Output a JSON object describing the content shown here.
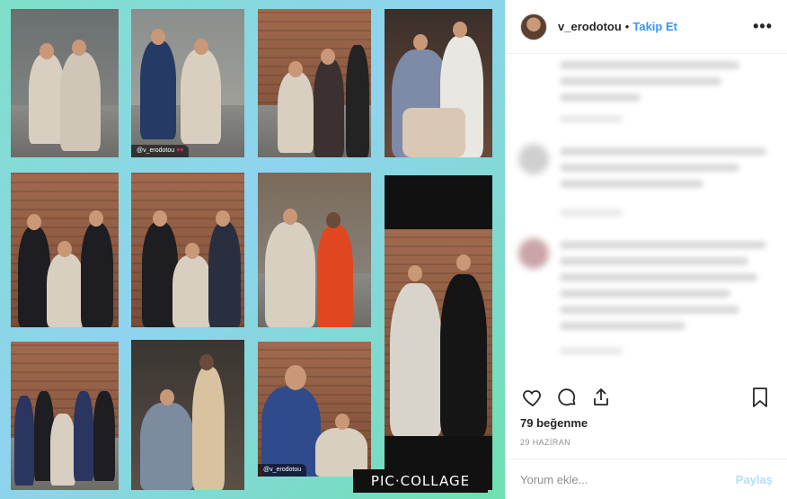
{
  "header": {
    "username": "v_erodotou",
    "separator": "•",
    "follow_label": "Takip Et",
    "more_label": "•••"
  },
  "photo": {
    "tag_text": "@v_erodotou",
    "hearts": "♥♥",
    "brand": "PIC·COLLAGE"
  },
  "actions": {
    "like_icon": "heart-outline-icon",
    "comment_icon": "comment-icon",
    "share_icon": "share-icon",
    "save_icon": "bookmark-icon"
  },
  "likes_label": "79 beğenme",
  "date_label": "29 HAZİRAN",
  "comment_box": {
    "placeholder": "Yorum ekle...",
    "post_label": "Paylaş"
  },
  "colors": {
    "link_blue": "#3897f0",
    "post_disabled": "#b2dffc",
    "muted": "#8e8e8e"
  }
}
